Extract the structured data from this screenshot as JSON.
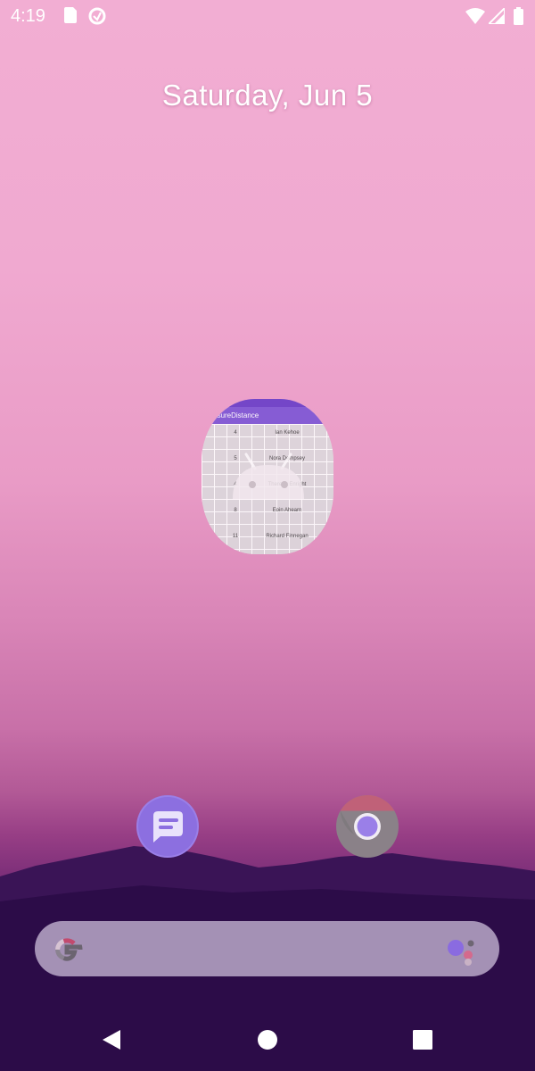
{
  "status_bar": {
    "time": "4:19",
    "left_icons": [
      "sd-card-icon",
      "data-saver-icon"
    ],
    "right_icons": [
      "wifi-icon",
      "cellular-signal-icon",
      "battery-icon"
    ]
  },
  "home": {
    "date": "Saturday, Jun 5"
  },
  "app_preview": {
    "title": "MeasureDistance",
    "rows": [
      {
        "num": "4",
        "name": "Ian Kehoe"
      },
      {
        "num": "5",
        "name": "Nora Dempsey"
      },
      {
        "num": "4",
        "name": "Theresa Enright"
      },
      {
        "num": "8",
        "name": "Eoin Ahearn"
      },
      {
        "num": "11",
        "name": "Richard Finnegan"
      }
    ]
  },
  "dock": {
    "apps": [
      {
        "name": "Messages",
        "icon": "messages-icon"
      },
      {
        "name": "Chrome",
        "icon": "chrome-icon"
      }
    ]
  },
  "search_bar": {
    "left_icon": "google-g-icon",
    "right_icon": "google-assistant-icon"
  },
  "nav_bar": {
    "buttons": [
      "back-button",
      "home-button",
      "recents-button"
    ]
  },
  "colors": {
    "accent": "#7e57d6",
    "wallpaper_top": "#f2aed3",
    "wallpaper_bottom": "#240a40"
  }
}
